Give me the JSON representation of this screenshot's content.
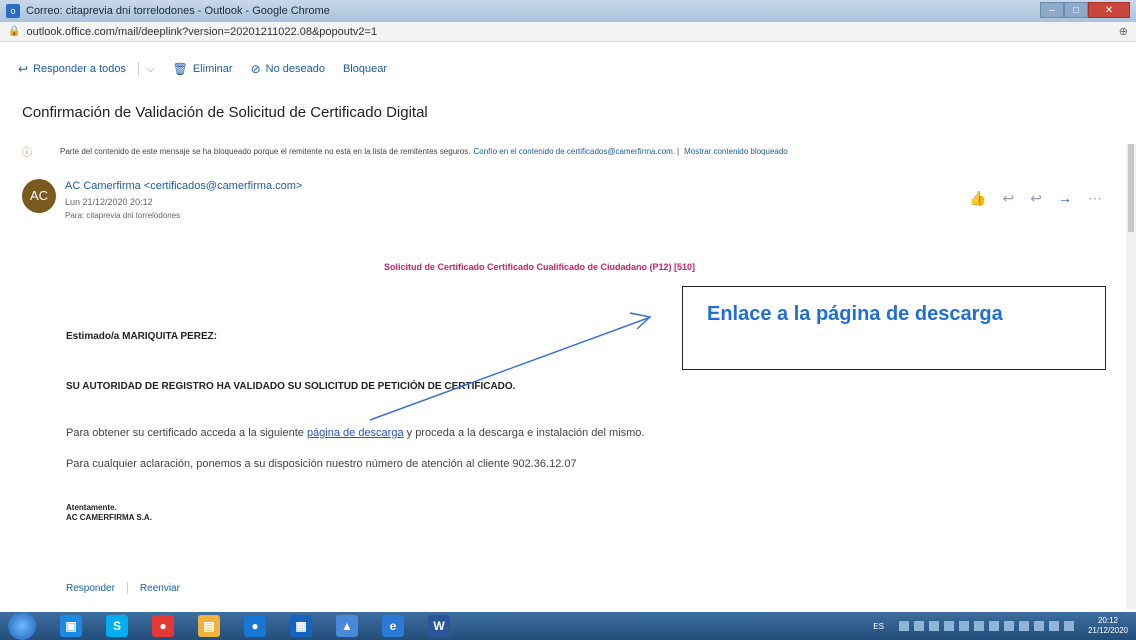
{
  "window": {
    "app_badge": "o",
    "title": "Correo: citaprevia dni torrelodones - Outlook - Google Chrome",
    "controls": {
      "minimize": "–",
      "maximize": "□",
      "close": "✕"
    }
  },
  "addressbar": {
    "url": "outlook.office.com/mail/deeplink?version=20201211022.08&popoutv2=1",
    "zoom_icon": "⊕"
  },
  "toolbar": {
    "reply_all": "Responder a todos",
    "delete": "Eliminar",
    "junk": "No deseado",
    "block": "Bloquear"
  },
  "message": {
    "subject": "Confirmación de Validación de Solicitud de Certificado Digital",
    "warning": {
      "text": "Parte del contenido de este mensaje se ha bloqueado porque el remitente no está en la lista de remitentes seguros.",
      "trust_link": "Confío en el contenido de certificados@camerfirma.com.",
      "separator": "|",
      "show_link": "Mostrar contenido bloqueado"
    },
    "avatar_initials": "AC",
    "sender": "AC Camerfirma <certificados@camerfirma.com>",
    "date": "Lun 21/12/2020 20:12",
    "to": "Para: citaprevia dni torrelodones",
    "body": {
      "title": "Solicitud de Certificado Certificado Cualificado de Ciudadano (P12) [510]",
      "greeting": "Estimado/a MARIQUITA PEREZ:",
      "authority_line": "SU AUTORIDAD DE REGISTRO HA VALIDADO SU SOLICITUD DE PETICIÓN DE CERTIFICADO.",
      "para1_before": "Para obtener su certificado acceda a la siguiente ",
      "para1_link": "página de descarga",
      "para1_after": " y proceda a la descarga e instalación del mismo.",
      "para2": "Para cualquier aclaración, ponemos a su disposición nuestro número de atención al cliente 902.36.12.07",
      "closing": "Atentamente.",
      "company": "AC CAMERFIRMA S.A."
    },
    "reply": "Responder",
    "forward": "Reenviar"
  },
  "annotation": {
    "text": "Enlace a la página de descarga"
  },
  "taskbar": {
    "language": "ES",
    "time": "20:12",
    "date": "21/12/2020",
    "apps": [
      {
        "label": "▣",
        "color": "#1e88e5"
      },
      {
        "label": "S",
        "color": "#00aff0"
      },
      {
        "label": "●",
        "color": "#e53935"
      },
      {
        "label": "▤",
        "color": "#f2b33d"
      },
      {
        "label": "●",
        "color": "#1976d2"
      },
      {
        "label": "▦",
        "color": "#1565c0"
      },
      {
        "label": "▲",
        "color": "#4a88d8"
      },
      {
        "label": "e",
        "color": "#2a7ad6"
      },
      {
        "label": "W",
        "color": "#2b579a"
      }
    ]
  }
}
